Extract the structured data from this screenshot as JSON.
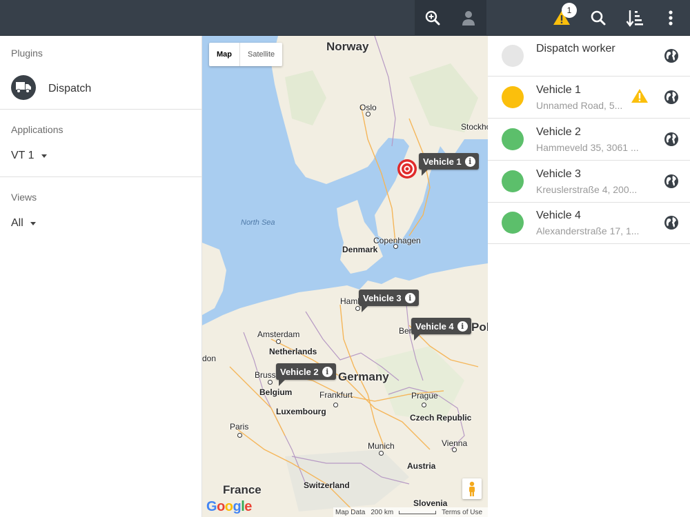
{
  "topbar": {
    "alert_count": "1",
    "icons": [
      "zoom-in-icon",
      "user-icon",
      "warning-icon",
      "search-icon",
      "sort-icon",
      "more-vert-icon"
    ],
    "background": "#37404a"
  },
  "left": {
    "plugins_title": "Plugins",
    "plugin_label": "Dispatch",
    "applications_title": "Applications",
    "application_value": "VT 1",
    "views_title": "Views",
    "view_value": "All"
  },
  "map": {
    "toggle": {
      "map_label": "Map",
      "satellite_label": "Satellite",
      "selected": "Map"
    },
    "countries": [
      "Norway",
      "Denmark",
      "Netherlands",
      "Germany",
      "Belgium",
      "Luxembourg",
      "Czech Republic",
      "Austria",
      "France",
      "Switzerland",
      "Slovenia",
      "Pol"
    ],
    "cities": [
      "Oslo",
      "Stockho",
      "Copenhagen",
      "Hamb",
      "Amsterdam",
      "Berl",
      "Bruss",
      "Frankfurt",
      "Prague",
      "Paris",
      "Munich",
      "Vienna",
      "don"
    ],
    "sea": "North Sea",
    "vehicle_markers": [
      "Vehicle 1",
      "Vehicle 2",
      "Vehicle 3",
      "Vehicle 4"
    ],
    "google": "Google",
    "map_data": "Map Data",
    "scale": "200 km",
    "terms": "Terms of Use",
    "colors": {
      "water": "#a9cdf0",
      "land": "#f3efe4",
      "marker": "#4b4b4b",
      "target": "#e02b2b"
    }
  },
  "vehicles": [
    {
      "name": "Dispatch worker",
      "address": "",
      "status_color": "#e6e6e6",
      "warning": false
    },
    {
      "name": "Vehicle 1",
      "address": "Unnamed Road, 5...",
      "status_color": "#fbbf0c",
      "warning": true
    },
    {
      "name": "Vehicle 2",
      "address": "Hammeveld 35, 3061 ...",
      "status_color": "#5cbf6b",
      "warning": false
    },
    {
      "name": "Vehicle 3",
      "address": "Kreuslerstraße 4, 200...",
      "status_color": "#5cbf6b",
      "warning": false
    },
    {
      "name": "Vehicle 4",
      "address": "Alexanderstraße 17, 1...",
      "status_color": "#5cbf6b",
      "warning": false
    }
  ]
}
